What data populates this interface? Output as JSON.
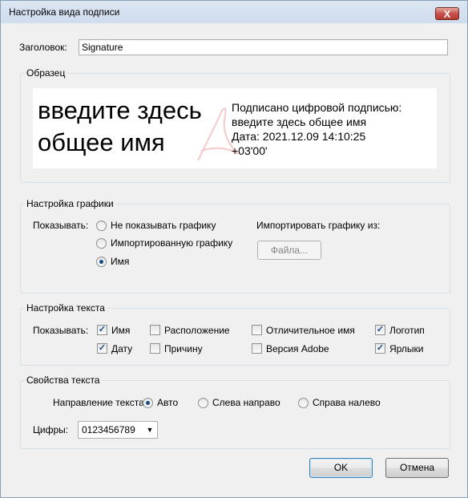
{
  "window": {
    "title": "Настройка вида подписи",
    "close_glyph": "X"
  },
  "header_field": {
    "label": "Заголовок:",
    "value": "Signature"
  },
  "sample": {
    "title": "Образец",
    "name": "введите здесь общее имя",
    "details": [
      "Подписано цифровой подписью:",
      "введите здесь общее имя",
      "Дата: 2021.12.09 14:10:25",
      "+03'00'"
    ]
  },
  "graphics": {
    "title": "Настройка графики",
    "show_label": "Показывать:",
    "options": [
      {
        "label": "Не показывать графику",
        "checked": false
      },
      {
        "label": "Импортированную графику",
        "checked": false
      },
      {
        "label": "Имя",
        "checked": true
      }
    ],
    "import_label": "Импортировать графику из:",
    "file_button": "Файла..."
  },
  "text": {
    "title": "Настройка текста",
    "show_label": "Показывать:",
    "checkboxes": [
      {
        "label": "Имя",
        "checked": true
      },
      {
        "label": "Расположение",
        "checked": false
      },
      {
        "label": "Отличительное имя",
        "checked": false
      },
      {
        "label": "Логотип",
        "checked": true
      },
      {
        "label": "Дату",
        "checked": true
      },
      {
        "label": "Причину",
        "checked": false
      },
      {
        "label": "Версия Adobe",
        "checked": false
      },
      {
        "label": "Ярлыки",
        "checked": true
      }
    ]
  },
  "properties": {
    "title": "Свойства текста",
    "direction_label": "Направление текста:",
    "direction_options": [
      {
        "label": "Авто",
        "checked": true
      },
      {
        "label": "Слева направо",
        "checked": false
      },
      {
        "label": "Справа налево",
        "checked": false
      }
    ],
    "digits_label": "Цифры:",
    "digits_value": "0123456789"
  },
  "buttons": {
    "ok": "OK",
    "cancel": "Отмена"
  },
  "colors": {
    "title_bar": "#cfdcec",
    "close_button": "#c75050",
    "accent": "#1c4a84",
    "group_border": "#d5dfe5"
  }
}
